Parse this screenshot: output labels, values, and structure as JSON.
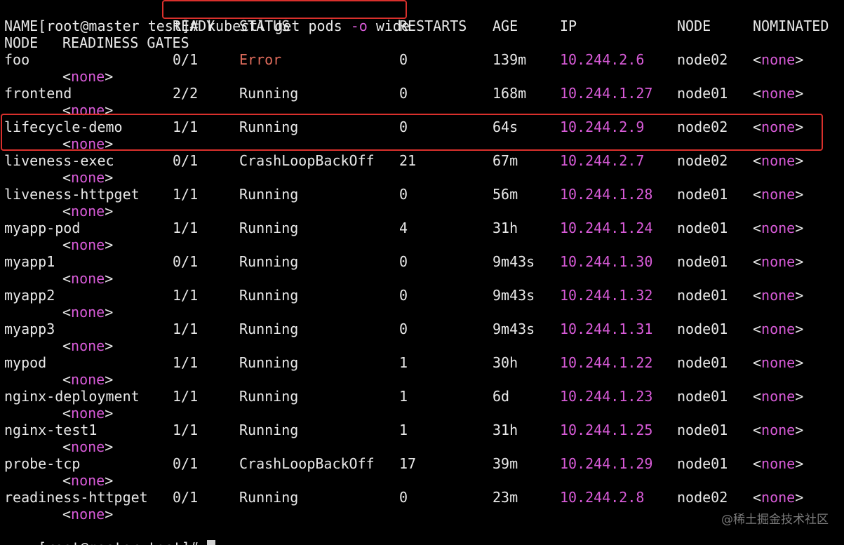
{
  "command_line": {
    "prompt": "[root@master test]#",
    "command": "kubectl get pods -o wide",
    "cmd_main": "kubectl get pods ",
    "cmd_flag": "-o",
    "cmd_arg": " wide"
  },
  "headers": {
    "name": "NAME",
    "ready": "READY",
    "status": "STATUS",
    "restarts": "RESTARTS",
    "age": "AGE",
    "ip": "IP",
    "node": "NODE",
    "nominated": "NOMINATED",
    "nominated_node": "NODE",
    "readiness_gates": "READINESS GATES"
  },
  "pods": [
    {
      "name": "foo",
      "ready": "0/1",
      "status": "Error",
      "restarts": "0",
      "age": "139m",
      "ip": "10.244.2.6",
      "node": "node02",
      "nominated": "none",
      "gates": "none"
    },
    {
      "name": "frontend",
      "ready": "2/2",
      "status": "Running",
      "restarts": "0",
      "age": "168m",
      "ip": "10.244.1.27",
      "node": "node01",
      "nominated": "none",
      "gates": "none"
    },
    {
      "name": "lifecycle-demo",
      "ready": "1/1",
      "status": "Running",
      "restarts": "0",
      "age": "64s",
      "ip": "10.244.2.9",
      "node": "node02",
      "nominated": "none",
      "gates": "none"
    },
    {
      "name": "liveness-exec",
      "ready": "0/1",
      "status": "CrashLoopBackOff",
      "restarts": "21",
      "age": "67m",
      "ip": "10.244.2.7",
      "node": "node02",
      "nominated": "none",
      "gates": "none"
    },
    {
      "name": "liveness-httpget",
      "ready": "1/1",
      "status": "Running",
      "restarts": "0",
      "age": "56m",
      "ip": "10.244.1.28",
      "node": "node01",
      "nominated": "none",
      "gates": "none"
    },
    {
      "name": "myapp-pod",
      "ready": "1/1",
      "status": "Running",
      "restarts": "4",
      "age": "31h",
      "ip": "10.244.1.24",
      "node": "node01",
      "nominated": "none",
      "gates": "none"
    },
    {
      "name": "myapp1",
      "ready": "0/1",
      "status": "Running",
      "restarts": "0",
      "age": "9m43s",
      "ip": "10.244.1.30",
      "node": "node01",
      "nominated": "none",
      "gates": "none"
    },
    {
      "name": "myapp2",
      "ready": "1/1",
      "status": "Running",
      "restarts": "0",
      "age": "9m43s",
      "ip": "10.244.1.32",
      "node": "node01",
      "nominated": "none",
      "gates": "none"
    },
    {
      "name": "myapp3",
      "ready": "1/1",
      "status": "Running",
      "restarts": "0",
      "age": "9m43s",
      "ip": "10.244.1.31",
      "node": "node01",
      "nominated": "none",
      "gates": "none"
    },
    {
      "name": "mypod",
      "ready": "1/1",
      "status": "Running",
      "restarts": "1",
      "age": "30h",
      "ip": "10.244.1.22",
      "node": "node01",
      "nominated": "none",
      "gates": "none"
    },
    {
      "name": "nginx-deployment",
      "ready": "1/1",
      "status": "Running",
      "restarts": "1",
      "age": "6d",
      "ip": "10.244.1.23",
      "node": "node01",
      "nominated": "none",
      "gates": "none"
    },
    {
      "name": "nginx-test1",
      "ready": "1/1",
      "status": "Running",
      "restarts": "1",
      "age": "31h",
      "ip": "10.244.1.25",
      "node": "node01",
      "nominated": "none",
      "gates": "none"
    },
    {
      "name": "probe-tcp",
      "ready": "0/1",
      "status": "CrashLoopBackOff",
      "restarts": "17",
      "age": "39m",
      "ip": "10.244.1.29",
      "node": "node01",
      "nominated": "none",
      "gates": "none"
    },
    {
      "name": "readiness-httpget",
      "ready": "0/1",
      "status": "Running",
      "restarts": "0",
      "age": "23m",
      "ip": "10.244.2.8",
      "node": "node02",
      "nominated": "none",
      "gates": "none"
    }
  ],
  "final_prompt": "[root@master test]#",
  "watermark": "@稀土掘金技术社区",
  "colors": {
    "background": "#000000",
    "text": "#e8e8e8",
    "ip": "#d85bd8",
    "error": "#e06c5c",
    "highlight_box": "#d9302c"
  }
}
